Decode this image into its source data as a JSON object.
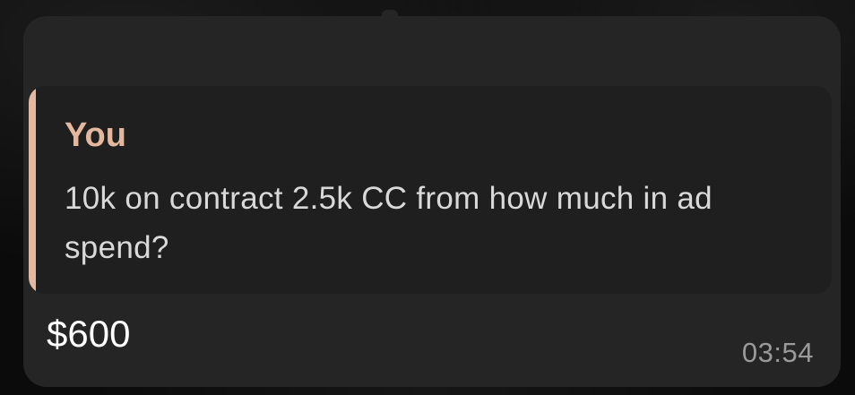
{
  "message": {
    "reply": {
      "author": "You",
      "text": "10k on contract 2.5k CC from how much in ad spend?"
    },
    "text": "$600",
    "time": "03:54"
  },
  "colors": {
    "bubble": "#252525",
    "quote_background": "#1f1f1f",
    "quote_accent": "#e4b89e",
    "message_text": "#ffffff",
    "quote_text": "#d9d9d9",
    "timestamp": "#9a9a9a"
  }
}
